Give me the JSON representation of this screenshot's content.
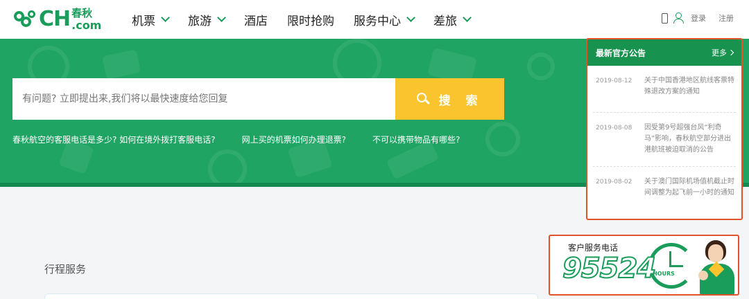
{
  "brand": {
    "logo_text": "CH",
    "logo_cn": "春秋",
    "logo_domain": ".com"
  },
  "nav": {
    "items": [
      {
        "label": "机票",
        "dropdown": true
      },
      {
        "label": "旅游",
        "dropdown": true
      },
      {
        "label": "酒店",
        "dropdown": false
      },
      {
        "label": "限时抢购",
        "dropdown": false
      },
      {
        "label": "服务中心",
        "dropdown": true
      },
      {
        "label": "差旅",
        "dropdown": true
      }
    ]
  },
  "header_right": {
    "login": "登录",
    "register": "注册"
  },
  "search": {
    "placeholder": "有问题? 立即提出来,我们将以最快速度给您回复",
    "button_label": "搜 索"
  },
  "quick_links": [
    "春秋航空的客服电话是多少? 如何在境外拨打客服电话?",
    "网上买的机票如何办理退票?",
    "不可以携带物品有哪些?"
  ],
  "notice": {
    "title": "最新官方公告",
    "more": "更多",
    "items": [
      {
        "date": "2019-08-12",
        "text": "关于中国香港地区航线客票特殊退改方案的通知"
      },
      {
        "date": "2019-08-08",
        "text": "因受第9号超强台风“利奇马”影响，春秋航空部分进出港航班被迫取消的公告"
      },
      {
        "date": "2019-08-02",
        "text": "关于澳门国际机场值机截止时间调整为起飞前一小时的通知"
      }
    ]
  },
  "content": {
    "section_title": "行程服务"
  },
  "hotline": {
    "label": "客户服务电话",
    "number": "95524",
    "hours": "HOURS"
  },
  "colors": {
    "brand_green": "#1fa464",
    "accent_yellow": "#f9c42d",
    "highlight_red": "#e0532d"
  }
}
